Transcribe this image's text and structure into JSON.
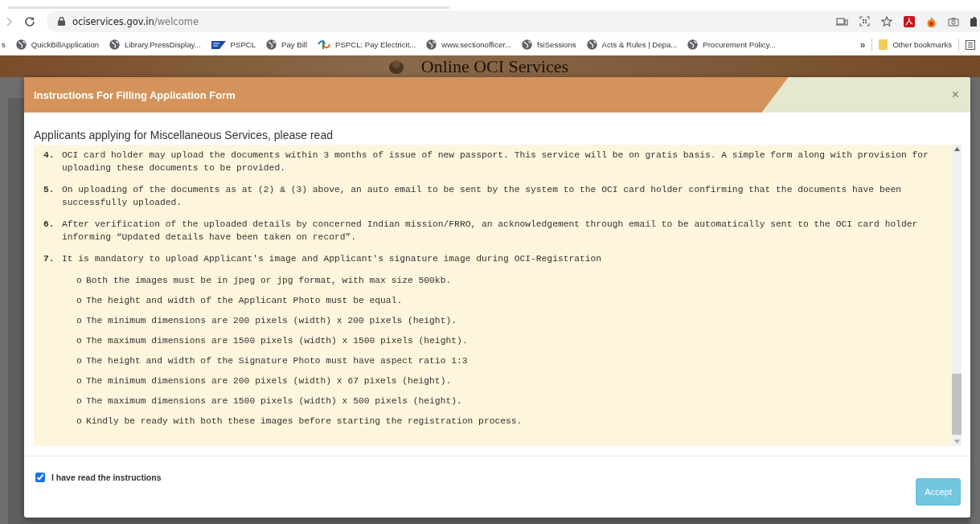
{
  "browser": {
    "url_domain": "ociservices.gov.in",
    "url_path": "/welcome",
    "bookmarks": [
      {
        "label": "s",
        "kind": "plain"
      },
      {
        "label": "QuickBillApplication",
        "kind": "site"
      },
      {
        "label": "Library.PressDisplay...",
        "kind": "site"
      },
      {
        "label": "PSPCL",
        "kind": "banner"
      },
      {
        "label": "Pay Bill",
        "kind": "site"
      },
      {
        "label": "PSPCL: Pay Electricit...",
        "kind": "emblem"
      },
      {
        "label": "www.sectionofficer...",
        "kind": "site"
      },
      {
        "label": "fsiSessions",
        "kind": "site"
      },
      {
        "label": "Acts & Rules | Depa...",
        "kind": "site"
      },
      {
        "label": "Procurement Policy...",
        "kind": "site"
      }
    ],
    "overflow": "»",
    "other_bookmarks": "Other bookmarks"
  },
  "page": {
    "site_title": "Online OCI Services"
  },
  "modal": {
    "title": "Instructions For Filling Application Form",
    "close": "×",
    "heading": "Applicants applying for Miscellaneous Services, please read",
    "items": [
      {
        "number": "4.",
        "text": "OCI card holder may upload the documents within 3 months of issue of new passport. This service will be on gratis basis. A simple form along with provision for uploading these documents to be provided."
      },
      {
        "number": "5.",
        "text": "On uploading of the documents as at (2) & (3) above, an auto email to be sent by the system to the OCI card holder confirming that the documents have been successfully uploaded."
      },
      {
        "number": "6.",
        "text": "After verification of the uploaded details by concerned Indian mission/FRRO, an acknowledgement through email to be automatically sent to the OCI card holder informing “Updated details have been taken on record”."
      },
      {
        "number": "7.",
        "text": "It is mandatory to upload Applicant's image and Applicant's signature image during OCI-Registration",
        "children": [
          {
            "marker": "o",
            "text": "Both the images must be in jpeg or jpg format, with max size 500kb."
          },
          {
            "marker": "o",
            "text": "The height and width of the Applicant Photo must be equal."
          },
          {
            "marker": "o",
            "text": "The minimum dimensions are 200 pixels (width) x 200 pixels (height)."
          },
          {
            "marker": "o",
            "text": "The maximum dimensions are 1500 pixels (width) x 1500 pixels (height)."
          },
          {
            "marker": "o",
            "text": "The height and width of the Signature Photo must have aspect ratio 1:3"
          },
          {
            "marker": "o",
            "text": "The minimum dimensions are 200 pixels (width) x 67 pixels (height)."
          },
          {
            "marker": "o",
            "text": "The maximum dimensions are 1500 pixels (width) x 500 pixels (height)."
          },
          {
            "marker": "o",
            "text": "Kindly be ready with both these images before starting the registration process."
          }
        ]
      }
    ],
    "checkbox": {
      "label": "I have read the instructions",
      "checked": true
    },
    "accept_button": "Accept"
  }
}
